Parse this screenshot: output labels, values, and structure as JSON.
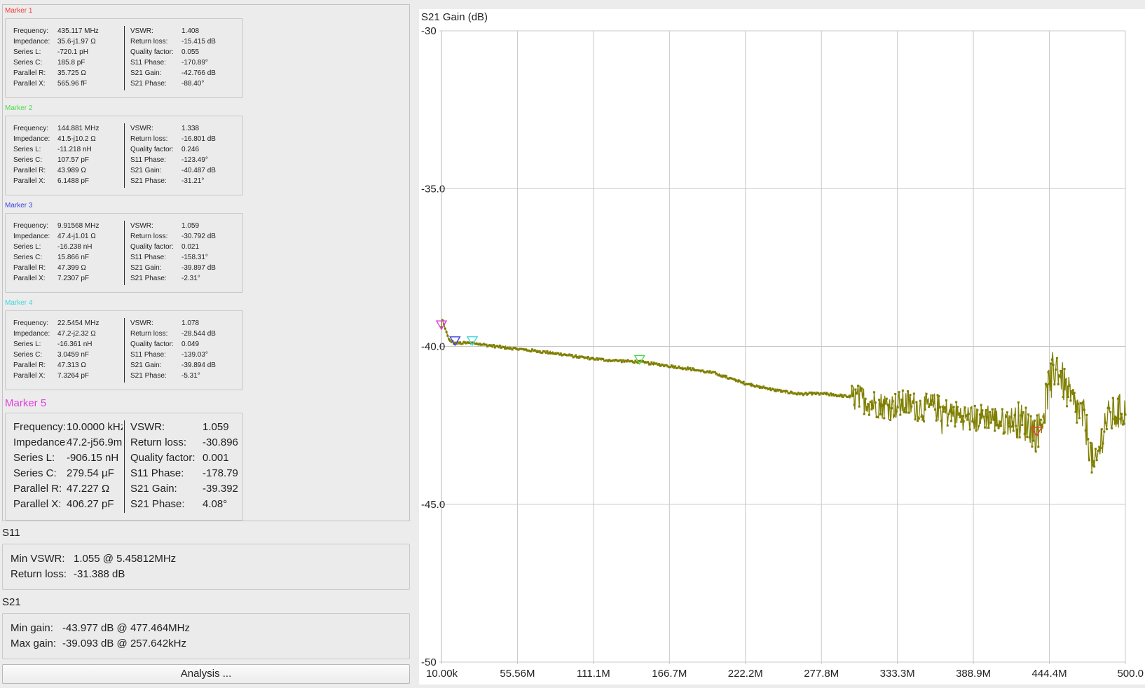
{
  "markers": [
    {
      "title": "Marker 1",
      "color": "#f03c3c",
      "left": [
        [
          "Frequency:",
          "435.117 MHz"
        ],
        [
          "Impedance:",
          "35.6-j1.97 Ω"
        ],
        [
          "Series L:",
          "-720.1 pH"
        ],
        [
          "Series C:",
          "185.8 pF"
        ],
        [
          "Parallel R:",
          "35.725 Ω"
        ],
        [
          "Parallel X:",
          "565.96 fF"
        ]
      ],
      "right": [
        [
          "VSWR:",
          "1.408"
        ],
        [
          "Return loss:",
          "-15.415 dB"
        ],
        [
          "Quality factor:",
          "0.055"
        ],
        [
          "S11 Phase:",
          "-170.89°"
        ],
        [
          "S21 Gain:",
          "-42.766 dB"
        ],
        [
          "S21 Phase:",
          "-88.40°"
        ]
      ]
    },
    {
      "title": "Marker 2",
      "color": "#4cd84c",
      "left": [
        [
          "Frequency:",
          "144.881 MHz"
        ],
        [
          "Impedance:",
          "41.5-j10.2 Ω"
        ],
        [
          "Series L:",
          "-11.218 nH"
        ],
        [
          "Series C:",
          "107.57 pF"
        ],
        [
          "Parallel R:",
          "43.989 Ω"
        ],
        [
          "Parallel X:",
          "6.1488 pF"
        ]
      ],
      "right": [
        [
          "VSWR:",
          "1.338"
        ],
        [
          "Return loss:",
          "-16.801 dB"
        ],
        [
          "Quality factor:",
          "0.246"
        ],
        [
          "S11 Phase:",
          "-123.49°"
        ],
        [
          "S21 Gain:",
          "-40.487 dB"
        ],
        [
          "S21 Phase:",
          "-31.21°"
        ]
      ]
    },
    {
      "title": "Marker 3",
      "color": "#4040e0",
      "left": [
        [
          "Frequency:",
          "9.91568 MHz"
        ],
        [
          "Impedance:",
          "47.4-j1.01 Ω"
        ],
        [
          "Series L:",
          "-16.238 nH"
        ],
        [
          "Series C:",
          "15.866 nF"
        ],
        [
          "Parallel R:",
          "47.399 Ω"
        ],
        [
          "Parallel X:",
          "7.2307 pF"
        ]
      ],
      "right": [
        [
          "VSWR:",
          "1.059"
        ],
        [
          "Return loss:",
          "-30.792 dB"
        ],
        [
          "Quality factor:",
          "0.021"
        ],
        [
          "S11 Phase:",
          "-158.31°"
        ],
        [
          "S21 Gain:",
          "-39.897 dB"
        ],
        [
          "S21 Phase:",
          "-2.31°"
        ]
      ]
    },
    {
      "title": "Marker 4",
      "color": "#40d8d8",
      "left": [
        [
          "Frequency:",
          "22.5454 MHz"
        ],
        [
          "Impedance:",
          "47.2-j2.32 Ω"
        ],
        [
          "Series L:",
          "-16.361 nH"
        ],
        [
          "Series C:",
          "3.0459 nF"
        ],
        [
          "Parallel R:",
          "47.313 Ω"
        ],
        [
          "Parallel X:",
          "7.3264 pF"
        ]
      ],
      "right": [
        [
          "VSWR:",
          "1.078"
        ],
        [
          "Return loss:",
          "-28.544 dB"
        ],
        [
          "Quality factor:",
          "0.049"
        ],
        [
          "S11 Phase:",
          "-139.03°"
        ],
        [
          "S21 Gain:",
          "-39.894 dB"
        ],
        [
          "S21 Phase:",
          "-5.31°"
        ]
      ]
    },
    {
      "title": "Marker 5",
      "color": "#e040e0",
      "left": [
        [
          "Frequency:",
          "10.0000 kHz"
        ],
        [
          "Impedance:",
          "47.2-j56.9m"
        ],
        [
          "Series L:",
          "-906.15 nH"
        ],
        [
          "Series C:",
          "279.54 µF"
        ],
        [
          "Parallel R:",
          "47.227 Ω"
        ],
        [
          "Parallel X:",
          "406.27 pF"
        ]
      ],
      "right": [
        [
          "VSWR:",
          "1.059"
        ],
        [
          "Return loss:",
          "-30.896"
        ],
        [
          "Quality factor:",
          "0.001"
        ],
        [
          "S11 Phase:",
          "-178.79"
        ],
        [
          "S21 Gain:",
          "-39.392"
        ],
        [
          "S21 Phase:",
          "4.08°"
        ]
      ]
    }
  ],
  "s11": {
    "label": "S11",
    "min_vswr_label": "Min VSWR:",
    "min_vswr_value": "1.055 @ 5.45812MHz",
    "return_loss_label": "Return loss:",
    "return_loss_value": "-31.388 dB"
  },
  "s21": {
    "label": "S21",
    "min_gain_label": "Min gain:",
    "min_gain_value": "-43.977 dB @ 477.464MHz",
    "max_gain_label": "Max gain:",
    "max_gain_value": "-39.093 dB @ 257.642kHz"
  },
  "analysis_button": "Analysis ...",
  "chart_data": {
    "type": "line",
    "title": "S21 Gain (dB)",
    "xlabel": "",
    "ylabel": "",
    "x_unit": "MHz",
    "ylim": [
      -50,
      -30
    ],
    "xlim": [
      0.01,
      500
    ],
    "x_tick_labels": [
      "10.00k",
      "55.56M",
      "111.1M",
      "166.7M",
      "222.2M",
      "277.8M",
      "333.3M",
      "388.9M",
      "444.4M",
      "500.0"
    ],
    "y_tick_labels": [
      "-30",
      "-35.0",
      "-40.0",
      "-45.0",
      "-50"
    ],
    "y_tick_values": [
      -30,
      -35,
      -40,
      -45,
      -50
    ],
    "grid": true,
    "line_color": "#7f7f00",
    "series": [
      {
        "x": [
          0.01,
          0.26,
          5.5,
          10,
          22.5,
          40,
          60,
          80,
          100,
          120,
          144.9,
          160,
          180,
          200,
          220,
          240,
          260,
          280,
          300,
          310,
          320,
          330,
          340,
          350,
          360,
          370,
          380,
          390,
          400,
          410,
          420,
          430,
          435,
          440,
          445,
          450,
          455,
          460,
          470,
          477.5,
          485,
          490,
          500
        ],
        "y": [
          -39.39,
          -39.09,
          -39.8,
          -39.9,
          -39.89,
          -40.0,
          -40.1,
          -40.2,
          -40.33,
          -40.43,
          -40.49,
          -40.58,
          -40.7,
          -40.85,
          -41.15,
          -41.35,
          -41.5,
          -41.5,
          -41.6,
          -41.7,
          -41.85,
          -41.9,
          -41.8,
          -41.95,
          -41.9,
          -42.1,
          -42.2,
          -42.3,
          -42.2,
          -42.4,
          -42.3,
          -42.5,
          -42.77,
          -42.2,
          -41.0,
          -40.6,
          -41.2,
          -41.7,
          -42.3,
          -43.98,
          -42.4,
          -42.2,
          -42.0
        ]
      }
    ],
    "markers": [
      {
        "name": "Marker 1",
        "x": 435.117,
        "y": -42.766,
        "color": "#f03c3c"
      },
      {
        "name": "Marker 2",
        "x": 144.881,
        "y": -40.487,
        "color": "#4cd84c"
      },
      {
        "name": "Marker 3",
        "x": 9.91568,
        "y": -39.897,
        "color": "#4040e0"
      },
      {
        "name": "Marker 4",
        "x": 22.5454,
        "y": -39.894,
        "color": "#40d8d8"
      },
      {
        "name": "Marker 5",
        "x": 0.01,
        "y": -39.392,
        "color": "#e040e0"
      }
    ]
  }
}
